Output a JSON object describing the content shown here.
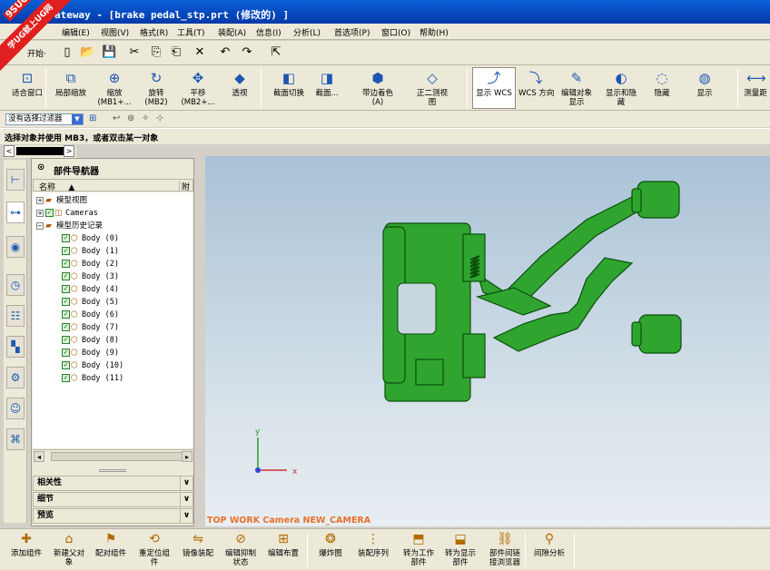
{
  "watermark": {
    "tag": "9SUG",
    "text": "学UG就上UG网"
  },
  "window": {
    "title": "ateway - [brake pedal_stp.prt (修改的) ]"
  },
  "menu": [
    "编辑(E)",
    "视图(V)",
    "格式(R)",
    "工具(T)",
    "装配(A)",
    "信息(I)",
    "分析(L)",
    "首选项(P)",
    "窗口(O)",
    "帮助(H)"
  ],
  "toolbar1": {
    "start_label": "开始·",
    "icons": [
      "new-icon",
      "open-icon",
      "save-icon",
      "cut-icon",
      "copy-icon",
      "paste-icon",
      "delete-icon",
      "undo-icon",
      "redo-icon",
      "select-icon"
    ],
    "glyphs": [
      "▯",
      "📂",
      "💾",
      "✂",
      "⎘",
      "⎗",
      "✕",
      "↶",
      "↷",
      "⇱"
    ]
  },
  "toolbar2": [
    {
      "label": "适合窗口",
      "glyph": "⊡"
    },
    {
      "label": "局部缩放",
      "glyph": "⧉"
    },
    {
      "label": "缩放\n(MB1+...",
      "glyph": "⊕"
    },
    {
      "label": "旋转\n(MB2)",
      "glyph": "↻"
    },
    {
      "label": "平移\n(MB2+...",
      "glyph": "✥"
    },
    {
      "label": "透视",
      "glyph": "◆"
    },
    {
      "label": "截面切换",
      "glyph": "◧"
    },
    {
      "label": "截面...",
      "glyph": "◨"
    },
    {
      "label": "带边着色\n(A)",
      "glyph": "⬢"
    },
    {
      "label": "正二测视\n图",
      "glyph": "◇"
    },
    {
      "label": "显示 WCS",
      "glyph": "⤴"
    },
    {
      "label": "WCS 方向",
      "glyph": "⤵"
    },
    {
      "label": "编辑对象\n显示",
      "glyph": "✎"
    },
    {
      "label": "显示和隐\n藏",
      "glyph": "◐"
    },
    {
      "label": "隐藏",
      "glyph": "◌"
    },
    {
      "label": "显示",
      "glyph": "◍"
    },
    {
      "label": "测量距",
      "glyph": "⟷"
    }
  ],
  "filter": {
    "value": "没有选择过滤器"
  },
  "prompt": "选择对象并使用 MB3，或者双击某一对象",
  "navigator": {
    "title": "部件导航器",
    "col_name": "名称",
    "col_sort": "▲",
    "col_extra": "附注",
    "tree": [
      {
        "label": "模型视图",
        "level": 0,
        "exp": "+",
        "kind": "folder"
      },
      {
        "label": "Cameras",
        "level": 0,
        "exp": "+",
        "kind": "camera"
      },
      {
        "label": "模型历史记录",
        "level": 0,
        "exp": "−",
        "kind": "folder"
      },
      {
        "label": "Body (0)",
        "level": 1,
        "kind": "body"
      },
      {
        "label": "Body (1)",
        "level": 1,
        "kind": "body"
      },
      {
        "label": "Body (2)",
        "level": 1,
        "kind": "body"
      },
      {
        "label": "Body (3)",
        "level": 1,
        "kind": "body"
      },
      {
        "label": "Body (4)",
        "level": 1,
        "kind": "body"
      },
      {
        "label": "Body (5)",
        "level": 1,
        "kind": "body"
      },
      {
        "label": "Body (6)",
        "level": 1,
        "kind": "body"
      },
      {
        "label": "Body (7)",
        "level": 1,
        "kind": "body"
      },
      {
        "label": "Body (8)",
        "level": 1,
        "kind": "body"
      },
      {
        "label": "Body (9)",
        "level": 1,
        "kind": "body"
      },
      {
        "label": "Body (10)",
        "level": 1,
        "kind": "body"
      },
      {
        "label": "Body (11)",
        "level": 1,
        "kind": "body"
      }
    ],
    "panels": [
      "相关性",
      "细节",
      "预览"
    ]
  },
  "viewport": {
    "caption": "TOP WORK Camera NEW_CAMERA",
    "axis_x": "x",
    "axis_y": "y",
    "model_color": "#2fa52f",
    "model_edge": "#0b4f0b"
  },
  "toolbar4": [
    {
      "label": "添加组件",
      "glyph": "✚"
    },
    {
      "label": "新建父对\n象",
      "glyph": "⌂"
    },
    {
      "label": "配对组件",
      "glyph": "⚑"
    },
    {
      "label": "重定位组\n件",
      "glyph": "⟲"
    },
    {
      "label": "镜像装配",
      "glyph": "⇋"
    },
    {
      "label": "编辑抑制\n状态",
      "glyph": "⊘"
    },
    {
      "label": "编辑布置",
      "glyph": "⊞"
    },
    {
      "label": "爆炸图",
      "glyph": "❂"
    },
    {
      "label": "装配序列",
      "glyph": "⋮"
    },
    {
      "label": "转为工作\n部件",
      "glyph": "⬒"
    },
    {
      "label": "转为显示\n部件",
      "glyph": "⬓"
    },
    {
      "label": "部件间链\n接浏览器",
      "glyph": "⛓"
    },
    {
      "label": "间隙分析",
      "glyph": "⚲"
    }
  ]
}
